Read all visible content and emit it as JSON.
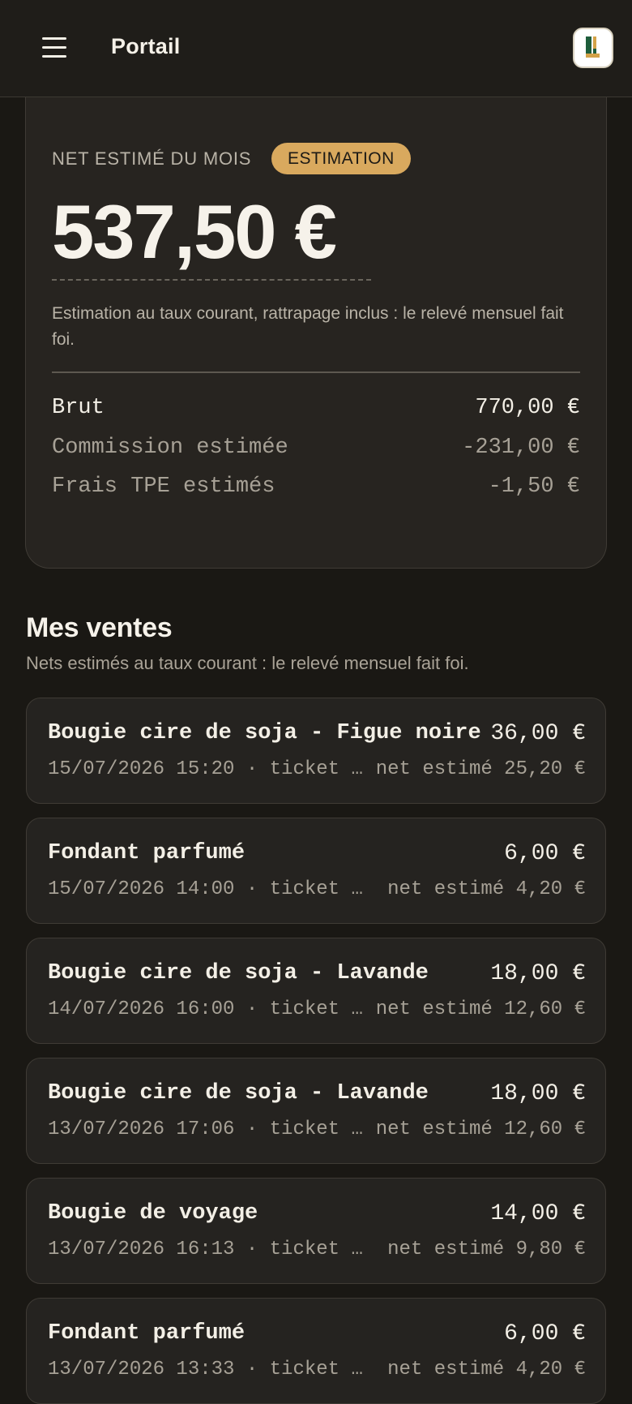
{
  "header": {
    "title": "Portail",
    "menu_icon": "hamburger-menu-icon",
    "logo_icon": "brand-logo-icon",
    "colors": {
      "logo_dark": "#1e5d3b",
      "logo_gold": "#d3a248"
    }
  },
  "summary": {
    "label": "NET ESTIMÉ DU MOIS",
    "badge": "ESTIMATION",
    "net_amount": "537,50 €",
    "note": "Estimation au taux courant, rattrapage inclus : le relevé mensuel fait foi.",
    "breakdown": [
      {
        "label": "Brut",
        "value": "770,00 €"
      },
      {
        "label": "Commission estimée",
        "value": "-231,00 €"
      },
      {
        "label": "Frais TPE estimés",
        "value": "-1,50 €"
      }
    ]
  },
  "sales_section": {
    "title": "Mes ventes",
    "subtitle": "Nets estimés au taux courant : le relevé mensuel fait foi.",
    "items": [
      {
        "name": "Bougie cire de soja - Figue noire",
        "price": "36,00 €",
        "meta": "15/07/2026 15:20 · ticket …",
        "net": "net estimé 25,20 €"
      },
      {
        "name": "Fondant parfumé",
        "price": "6,00 €",
        "meta": "15/07/2026 14:00 · ticket n…",
        "net": "net estimé 4,20 €"
      },
      {
        "name": "Bougie cire de soja - Lavande",
        "price": "18,00 €",
        "meta": "14/07/2026 16:00 · ticket …",
        "net": "net estimé 12,60 €"
      },
      {
        "name": "Bougie cire de soja - Lavande",
        "price": "18,00 €",
        "meta": "13/07/2026 17:06 · ticket …",
        "net": "net estimé 12,60 €"
      },
      {
        "name": "Bougie de voyage",
        "price": "14,00 €",
        "meta": "13/07/2026 16:13 · ticket n…",
        "net": "net estimé 9,80 €"
      },
      {
        "name": "Fondant parfumé",
        "price": "6,00 €",
        "meta": "13/07/2026 13:33 · ticket n…",
        "net": "net estimé 4,20 €"
      }
    ]
  },
  "colors": {
    "background": "#1a1814",
    "card": "#272420",
    "accent_badge": "#d9a95e",
    "text_primary": "#f3efe6",
    "text_muted": "#a7a196"
  }
}
